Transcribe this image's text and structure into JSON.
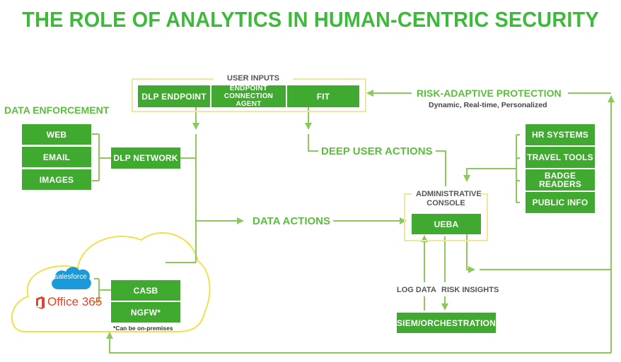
{
  "title": "THE ROLE OF ANALYTICS IN HUMAN-CENTRIC SECURITY",
  "colors": {
    "title_green": "#3dba3a",
    "box_green": "#40a92f",
    "line_green": "#8cc85a",
    "frame_yellow": "#efe89a",
    "cloud_yellow": "#f0e04a",
    "salesforce_blue": "#1b9ad9",
    "office_red": "#e1452a"
  },
  "user_inputs": {
    "label": "USER INPUTS",
    "boxes": [
      {
        "id": "dlp-endpoint",
        "label": "DLP ENDPOINT"
      },
      {
        "id": "endpoint-connection-agent",
        "label": "ENDPOINT CONNECTION AGENT"
      },
      {
        "id": "fit",
        "label": "FIT"
      }
    ]
  },
  "data_enforcement": {
    "heading": "DATA ENFORCEMENT",
    "channels": [
      "WEB",
      "EMAIL",
      "IMAGES"
    ],
    "dlp_network": "DLP NETWORK"
  },
  "risk_adaptive": {
    "label": "RISK-ADAPTIVE PROTECTION",
    "sublabel": "Dynamic, Real-time, Personalized"
  },
  "deep_user_actions": "DEEP USER ACTIONS",
  "data_actions": "DATA ACTIONS",
  "context_sources": [
    "HR SYSTEMS",
    "TRAVEL TOOLS",
    "BADGE READERS",
    "PUBLIC INFO"
  ],
  "admin_console": {
    "label": "ADMINISTRATIVE CONSOLE",
    "ueba": "UEBA"
  },
  "siem": {
    "label": "SIEM/ORCHESTRATION",
    "log_data": "LOG DATA",
    "risk_insights": "RISK INSIGHTS"
  },
  "cloud": {
    "salesforce": "salesforce",
    "office365": "Office 365",
    "casb": "CASB",
    "ngfw": "NGFW*",
    "note": "*Can be on-premises"
  }
}
